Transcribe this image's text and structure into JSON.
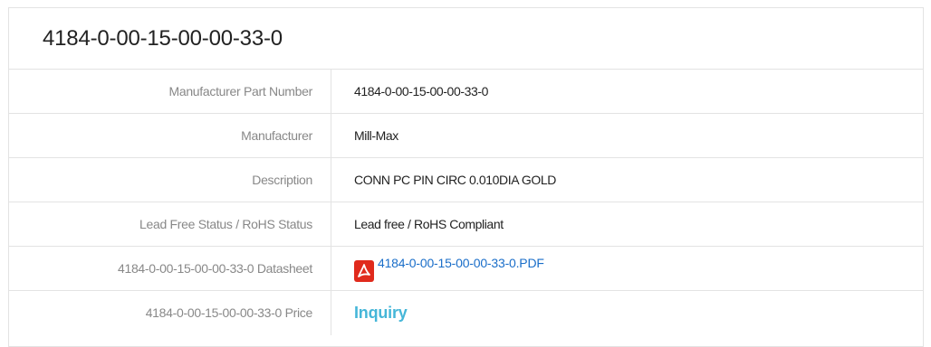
{
  "part": {
    "title": "4184-0-00-15-00-00-33-0",
    "rows": [
      {
        "label": "Manufacturer Part Number",
        "value": "4184-0-00-15-00-00-33-0"
      },
      {
        "label": "Manufacturer",
        "value": "Mill-Max"
      },
      {
        "label": "Description",
        "value": "CONN PC PIN CIRC 0.010DIA GOLD"
      },
      {
        "label": "Lead Free Status / RoHS Status",
        "value": "Lead free / RoHS Compliant"
      },
      {
        "label": "4184-0-00-15-00-00-33-0 Datasheet",
        "value": "4184-0-00-15-00-00-33-0.PDF"
      },
      {
        "label": "4184-0-00-15-00-00-33-0 Price",
        "value": "Inquiry"
      }
    ]
  },
  "icons": {
    "datasheet": "pdf-icon"
  },
  "colors": {
    "link": "#1a6ec9",
    "inquiry": "#45b6d8",
    "pdf_icon": "#e02a1c"
  }
}
